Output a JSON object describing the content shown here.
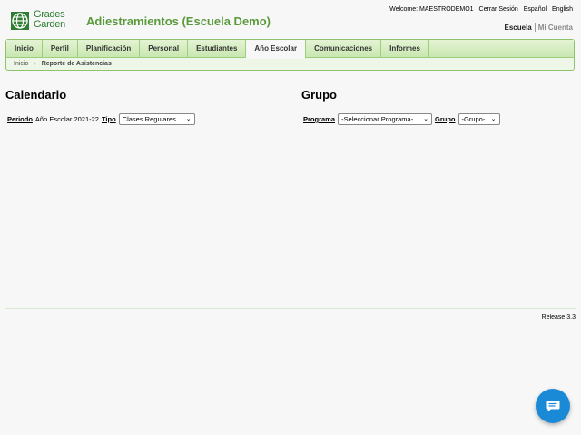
{
  "header": {
    "logo_line1": "Grades",
    "logo_line2": "Garden",
    "title": "Adiestramientos (Escuela Demo)",
    "welcome": "Welcome: MAESTRODEMO1",
    "logout": "Cerrar Sesión",
    "lang_es": "Español",
    "lang_en": "English",
    "context_active": "Escuela",
    "context_inactive": "Mi Cuenta"
  },
  "nav": {
    "tabs": [
      {
        "label": "Inicio"
      },
      {
        "label": "Perfil"
      },
      {
        "label": "Planificación"
      },
      {
        "label": "Personal"
      },
      {
        "label": "Estudiantes"
      },
      {
        "label": "Año Escolar"
      },
      {
        "label": "Comunicaciones"
      },
      {
        "label": "Informes"
      }
    ],
    "active_tab": "Año Escolar",
    "breadcrumb": {
      "home": "Inicio",
      "current": "Reporte de Asistencias"
    }
  },
  "calendario": {
    "heading": "Calendario",
    "periodo_label": "Periodo",
    "periodo_value": "Año Escolar 2021-22",
    "tipo_label": "Tipo",
    "tipo_selected": "Clases Regulares"
  },
  "grupo": {
    "heading": "Grupo",
    "programa_label": "Programa",
    "programa_selected": "-Seleccionar Programa-",
    "grupo_label": "Grupo",
    "grupo_selected": "-Grupo-"
  },
  "footer": {
    "release": "Release 3.3"
  },
  "colors": {
    "accent": "#5b9a3c",
    "chat": "#1b8ad6"
  },
  "icons": {
    "logo": "globe-logo-icon",
    "chat": "chat-bubble-icon"
  }
}
